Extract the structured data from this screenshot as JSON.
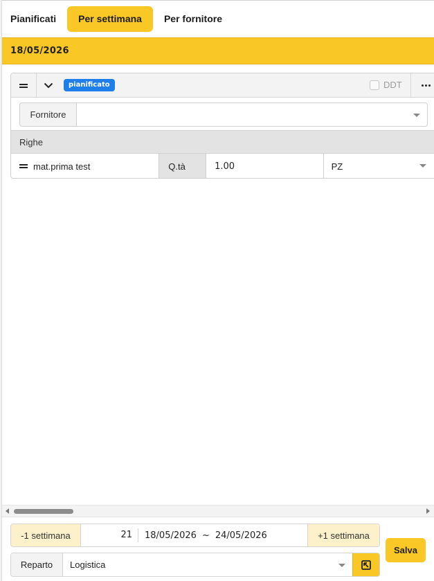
{
  "tabs": [
    {
      "label": "Pianificati",
      "active": false
    },
    {
      "label": "Per settimana",
      "active": true
    },
    {
      "label": "Per fornitore",
      "active": false
    }
  ],
  "date_header": "18/05/2026",
  "card": {
    "status_badge": "pianificato",
    "ddt_label": "DDT",
    "ddt_checked": false,
    "supplier_label": "Fornitore",
    "supplier_value": "",
    "rows_title": "Righe",
    "rows": [
      {
        "name": "mat.prima test",
        "qty_label": "Q.tà",
        "qty_value": "1.00",
        "unit": "PZ"
      }
    ]
  },
  "footer": {
    "prev_week": "-1 settimana",
    "week_number": "21",
    "range_start": "18/05/2026",
    "range_sep": "~",
    "range_end": "24/05/2026",
    "next_week": "+1 settimana",
    "save_label": "Salva",
    "dept_label": "Reparto",
    "dept_value": "Logistica"
  },
  "colors": {
    "accent": "#f9c726",
    "badge": "#1f7fea",
    "week_btn_bg": "#fdf1cc"
  },
  "icons": {
    "drag": "drag-handle-icon",
    "expand": "chevron-down-icon",
    "more": "more-horizontal-icon",
    "open_external": "open-external-icon"
  }
}
